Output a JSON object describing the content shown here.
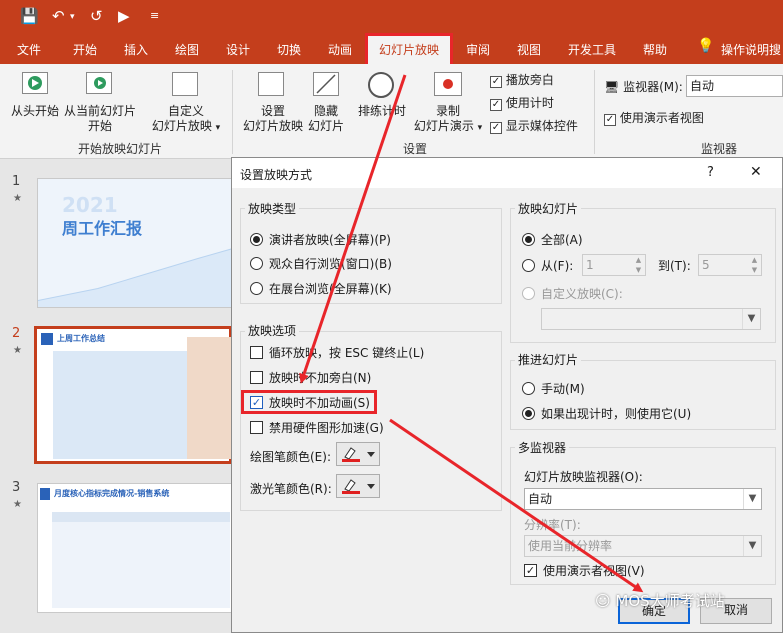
{
  "ribbon_tabs": [
    "文件",
    "开始",
    "插入",
    "绘图",
    "设计",
    "切换",
    "动画",
    "幻灯片放映",
    "审阅",
    "视图",
    "开发工具",
    "帮助",
    "操作说明搜"
  ],
  "ribbon": {
    "from_start": "从头开始",
    "from_current_l1": "从当前幻灯片",
    "from_current_l2": "开始",
    "custom_l1": "自定义",
    "custom_l2": "幻灯片放映",
    "group1_label": "开始放映幻灯片",
    "setup_l1": "设置",
    "setup_l2": "幻灯片放映",
    "hide_l1": "隐藏",
    "hide_l2": "幻灯片",
    "rehearse": "排练计时",
    "record_l1": "录制",
    "record_l2": "幻灯片演示",
    "cb_narration": "播放旁白",
    "cb_timing": "使用计时",
    "cb_media": "显示媒体控件",
    "group2_label": "设置",
    "monitor_label": "监视器(M):",
    "monitor_value": "自动",
    "presenter_view": "使用演示者视图",
    "group3_label": "监视器"
  },
  "slides": [
    {
      "num": "1",
      "title": "周工作汇报",
      "year": "2021"
    },
    {
      "num": "2",
      "title": "上周工作总结"
    },
    {
      "num": "3",
      "title": "月度核心指标完成情况-销售系统"
    }
  ],
  "dialog": {
    "title": "设置放映方式",
    "help": "?",
    "close": "✕",
    "show_type": {
      "legend": "放映类型",
      "options": [
        "演讲者放映(全屏幕)(P)",
        "观众自行浏览(窗口)(B)",
        "在展台浏览(全屏幕)(K)"
      ],
      "selected": 0
    },
    "show_options": {
      "legend": "放映选项",
      "items": [
        {
          "label": "循环放映，按 ESC 键终止(L)",
          "checked": false
        },
        {
          "label": "放映时不加旁白(N)",
          "checked": false
        },
        {
          "label": "放映时不加动画(S)",
          "checked": true
        },
        {
          "label": "禁用硬件图形加速(G)",
          "checked": false
        }
      ],
      "pen_color": "绘图笔颜色(E):",
      "laser_color": "激光笔颜色(R):"
    },
    "slides_range": {
      "legend": "放映幻灯片",
      "all": "全部(A)",
      "from": "从(F):",
      "from_value": "1",
      "to": "到(T):",
      "to_value": "5",
      "custom": "自定义放映(C):"
    },
    "advance": {
      "legend": "推进幻灯片",
      "manual": "手动(M)",
      "timing": "如果出现计时，则使用它(U)"
    },
    "multi_monitor": {
      "legend": "多监视器",
      "monitor_label": "幻灯片放映监视器(O):",
      "monitor_value": "自动",
      "resolution_label": "分辨率(T):",
      "resolution_value": "使用当前分辨率",
      "presenter_view": "使用演示者视图(V)"
    },
    "ok": "确定",
    "cancel": "取消"
  },
  "watermark": "MOS大师考试站",
  "colors": {
    "accent": "#c43e1c",
    "highlight": "#e8252a",
    "pen": "#e02020"
  }
}
